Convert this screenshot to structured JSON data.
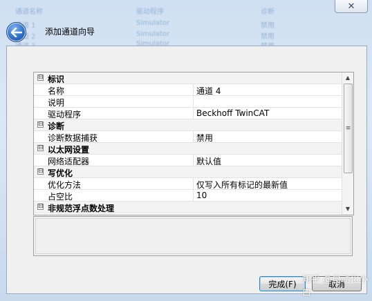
{
  "window": {
    "close_glyph": "✕"
  },
  "wizard": {
    "title": "添加通道向导"
  },
  "background_rows": [
    [
      "通道名称",
      "驱动程序",
      "诊断"
    ],
    [
      "通道 1",
      "Simulator",
      "禁用"
    ],
    [
      "通道 2",
      "Simulator",
      "禁用"
    ],
    [
      "通道 3",
      "Simulator",
      "禁用"
    ]
  ],
  "property_grid": {
    "sections": [
      {
        "title": "标识",
        "expander": "⊟",
        "rows": [
          {
            "name": "名称",
            "value": "通道 4"
          },
          {
            "name": "说明",
            "value": ""
          },
          {
            "name": "驱动程序",
            "value": "Beckhoff TwinCAT"
          }
        ]
      },
      {
        "title": "诊断",
        "expander": "⊟",
        "rows": [
          {
            "name": "诊断数据捕获",
            "value": "禁用"
          }
        ]
      },
      {
        "title": "以太网设置",
        "expander": "⊟",
        "rows": [
          {
            "name": "网络适配器",
            "value": "默认值"
          }
        ]
      },
      {
        "title": "写优化",
        "expander": "⊟",
        "rows": [
          {
            "name": "优化方法",
            "value": "仅写入所有标记的最新值"
          },
          {
            "name": "占空比",
            "value": "10"
          }
        ]
      },
      {
        "title": "非规范浮点数处理",
        "expander": "⊟",
        "rows": []
      }
    ]
  },
  "scrollbar": {
    "up": "▲",
    "down": "▼",
    "grip": "≡"
  },
  "buttons": {
    "finish": "完成(F)",
    "cancel": "取消"
  },
  "watermark": "知乎 @自动化小白",
  "icons": {
    "back": "back-arrow-icon",
    "close": "close-icon",
    "expander": "collapse-icon"
  }
}
